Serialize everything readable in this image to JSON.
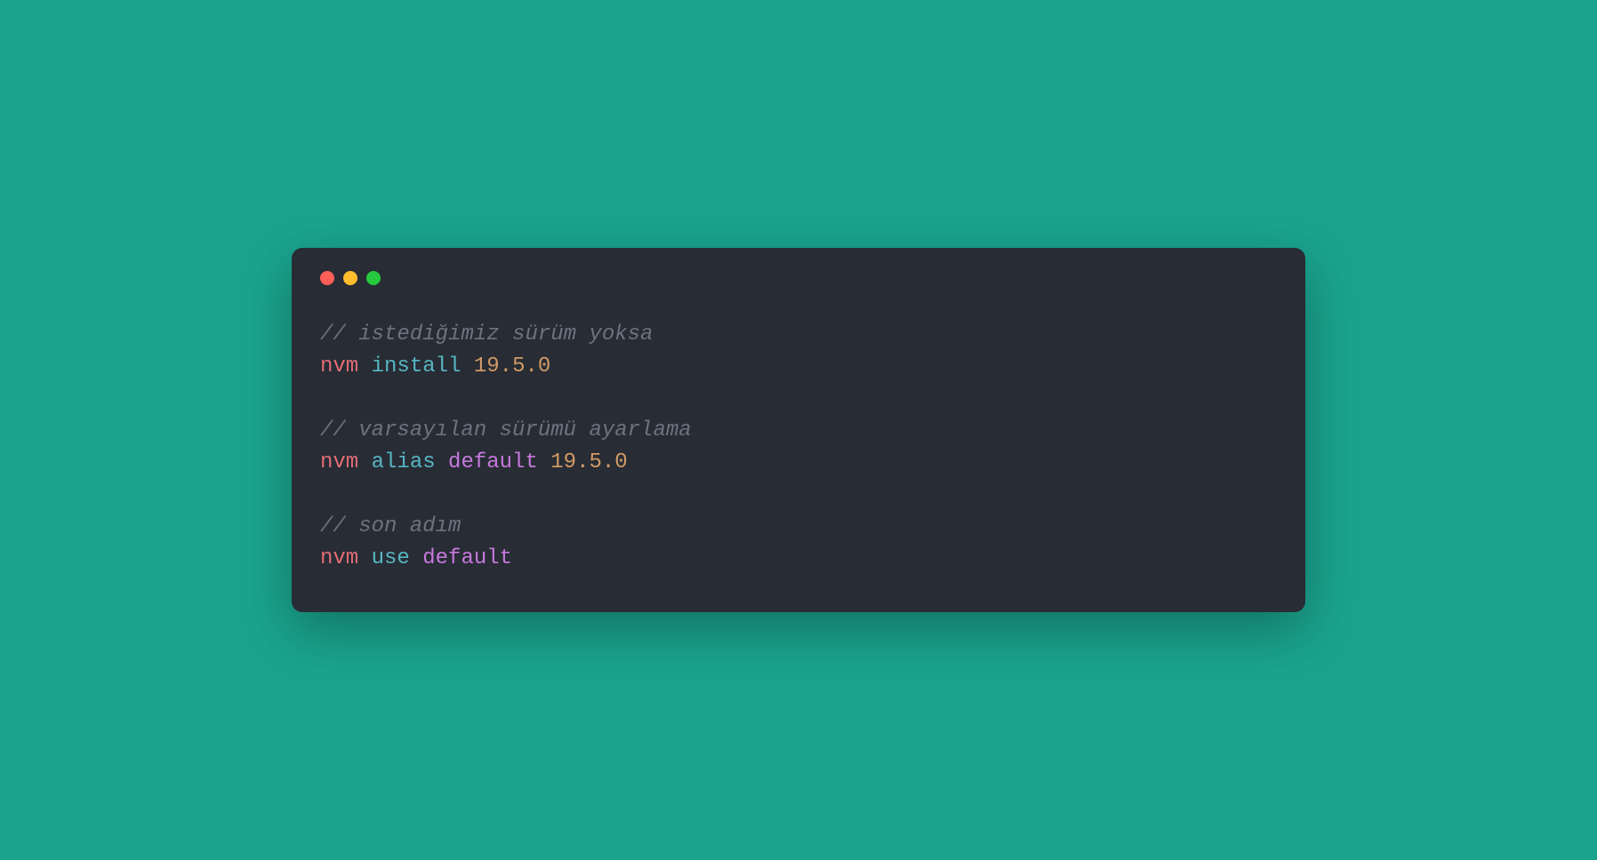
{
  "colors": {
    "background": "#1aa48e",
    "terminal_bg": "#282c34",
    "comment": "#6c7380",
    "red": "#e06c75",
    "teal": "#56b6c2",
    "orange": "#d19a66",
    "purple": "#c678dd",
    "traffic_red": "#ff5f56",
    "traffic_yellow": "#ffbd2e",
    "traffic_green": "#27c93f"
  },
  "blocks": [
    {
      "comment": "// istediğimiz sürüm yoksa",
      "tokens": [
        {
          "text": "nvm",
          "class": "tok-red"
        },
        {
          "text": " ",
          "class": ""
        },
        {
          "text": "install",
          "class": "tok-teal"
        },
        {
          "text": " ",
          "class": ""
        },
        {
          "text": "19.5.0",
          "class": "tok-orange"
        }
      ]
    },
    {
      "comment": "// varsayılan sürümü ayarlama",
      "tokens": [
        {
          "text": "nvm",
          "class": "tok-red"
        },
        {
          "text": " ",
          "class": ""
        },
        {
          "text": "alias",
          "class": "tok-teal"
        },
        {
          "text": " ",
          "class": ""
        },
        {
          "text": "default",
          "class": "tok-purple"
        },
        {
          "text": " ",
          "class": ""
        },
        {
          "text": "19.5.0",
          "class": "tok-orange"
        }
      ]
    },
    {
      "comment": "// son adım",
      "tokens": [
        {
          "text": "nvm",
          "class": "tok-red"
        },
        {
          "text": " ",
          "class": ""
        },
        {
          "text": "use",
          "class": "tok-teal"
        },
        {
          "text": " ",
          "class": ""
        },
        {
          "text": "default",
          "class": "tok-purple"
        }
      ]
    }
  ]
}
